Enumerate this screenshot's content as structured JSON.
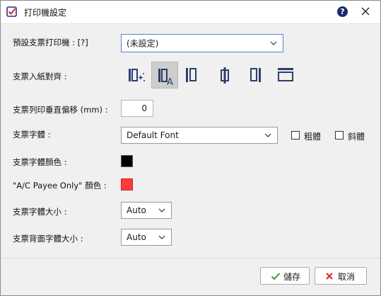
{
  "window": {
    "title": "打印機設定"
  },
  "form": {
    "printer_label": "預設支票打印機 : [?]",
    "printer_value": "(未設定)",
    "alignment_label": "支票入紙對齊 :",
    "offset_label": "支票列印垂直偏移 (mm) :",
    "offset_value": "0",
    "font_label": "支票字體 :",
    "font_value": "Default Font",
    "bold_label": "粗體",
    "italic_label": "斜體",
    "font_color_label": "支票字體顏色 :",
    "font_color": "#000000",
    "payee_color_label": "\"A/C Payee Only\" 顏色 :",
    "payee_color": "#ff3b3b",
    "font_size_label": "支票字體大小 :",
    "font_size_value": "Auto",
    "back_font_size_label": "支票背面字體大小 :",
    "back_font_size_value": "Auto"
  },
  "alignment_options": [
    "auto-align-icon",
    "align-left-text-icon",
    "align-left-icon",
    "align-center-icon",
    "align-right-icon",
    "align-top-icon"
  ],
  "footer": {
    "save_label": "儲存",
    "cancel_label": "取消"
  },
  "colors": {
    "accent_select": "#5a7fd6",
    "save_check": "#2e9a3e",
    "cancel_x": "#d9281f"
  }
}
